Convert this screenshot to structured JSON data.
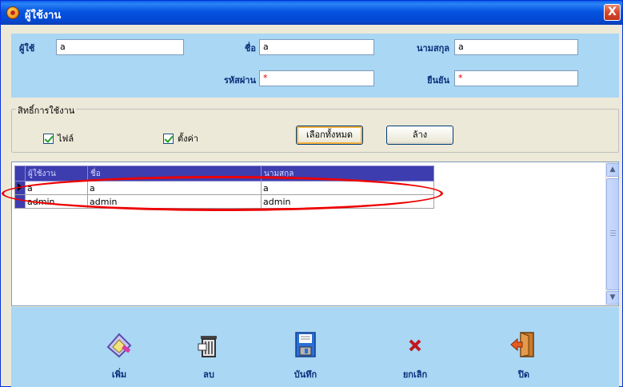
{
  "window": {
    "title": "ผู้ใช้งาน",
    "close_label": "X"
  },
  "form": {
    "user_label": "ผู้ใช้",
    "user_value": "a",
    "name_label": "ชื่อ",
    "name_value": "a",
    "surname_label": "นามสกุล",
    "surname_value": "a",
    "password_label": "รหัสผ่าน",
    "password_value": "*",
    "confirm_label": "ยืนยัน",
    "confirm_value": "*"
  },
  "permissions": {
    "title": "สิทธิ์การใช้งาน",
    "file_label": "ไฟล์",
    "settings_label": "ตั้งค่า",
    "select_all_label": "เลือกทั้งหมด",
    "clear_label": "ล้าง"
  },
  "grid": {
    "headers": [
      "ผู้ใช้งาน",
      "ชื่อ",
      "นามสกุล"
    ],
    "rows": [
      [
        "a",
        "a",
        "a"
      ],
      [
        "admin",
        "admin",
        "admin"
      ]
    ]
  },
  "toolbar": {
    "add_label": "เพิ่ม",
    "delete_label": "ลบ",
    "save_label": "บันทึก",
    "cancel_label": "ยกเลิก",
    "close_label": "ปิด"
  },
  "colors": {
    "panel": "#a9d7f4",
    "title_bar": "#0553e0",
    "grid_header": "#3d3daf",
    "annotation": "#e00000"
  }
}
